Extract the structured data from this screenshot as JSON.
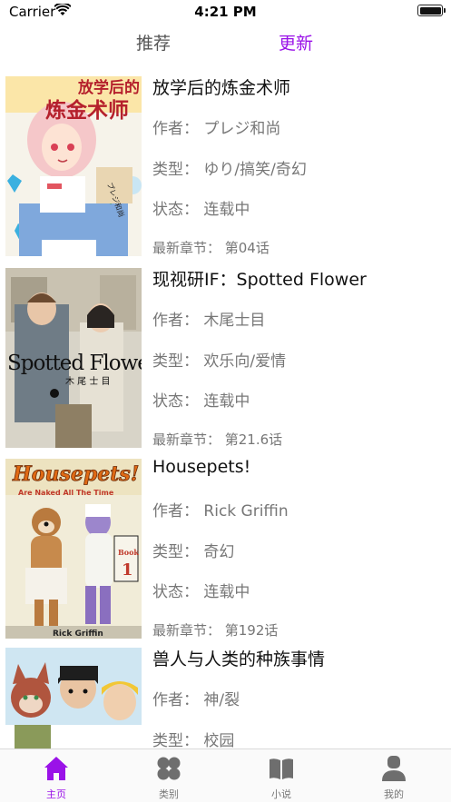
{
  "status_bar": {
    "carrier": "Carrier",
    "time": "4:21 PM"
  },
  "tabs": {
    "recommend": "推荐",
    "update": "更新"
  },
  "accent_color": "#9a12e8",
  "items": [
    {
      "title": "放学后的炼金术师",
      "author": "作者：  プレジ和尚",
      "type": "类型：  ゆり/搞笑/奇幻",
      "status": "状态：  连载中",
      "latest": "最新章节：  第04话",
      "cover_text": "放学后的炼金术师",
      "cover_author": "プレジ和尚"
    },
    {
      "title": "现视研IF：Spotted Flower",
      "author": "作者：  木尾士目",
      "type": "类型：  欢乐向/爱情",
      "status": "状态：  连载中",
      "latest": "最新章节：  第21.6话",
      "cover_text": "Spotted Flower",
      "cover_author": "木尾士目"
    },
    {
      "title": "Housepets!",
      "author": "作者：  Rick Griffin",
      "type": "类型：  奇幻",
      "status": "状态：  连载中",
      "latest": "最新章节：  第192话",
      "cover_text": "Housepets!",
      "cover_subtitle": "Are Naked All The Time",
      "cover_book": "Book",
      "cover_num": "1",
      "cover_author": "Rick Griffin"
    },
    {
      "title": "兽人与人类的种族事情",
      "author": "作者：  神/裂",
      "type": "类型：  校园"
    }
  ],
  "tabbar": [
    {
      "label": "主页",
      "icon": "home-icon"
    },
    {
      "label": "类别",
      "icon": "category-icon"
    },
    {
      "label": "小说",
      "icon": "book-icon"
    },
    {
      "label": "我的",
      "icon": "profile-icon"
    }
  ]
}
